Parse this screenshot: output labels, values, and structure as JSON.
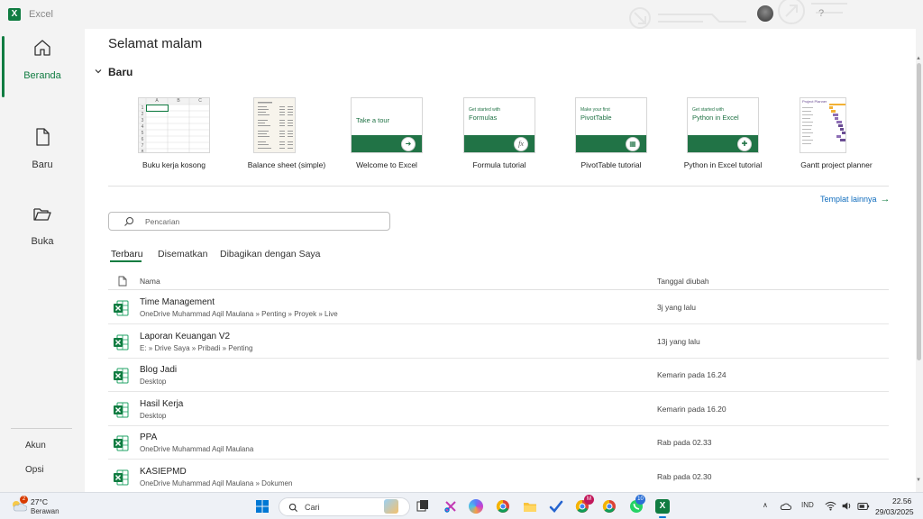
{
  "window": {
    "app_title": "Excel",
    "app_icon_letter": "X",
    "help": "?"
  },
  "nav": {
    "items": [
      {
        "label": "Beranda",
        "icon": "home-icon"
      },
      {
        "label": "Baru",
        "icon": "new-document-icon"
      },
      {
        "label": "Buka",
        "icon": "folder-open-icon"
      }
    ],
    "bottom": {
      "account": "Akun",
      "options": "Opsi"
    }
  },
  "main": {
    "greeting": "Selamat malam",
    "new_section_title": "Baru",
    "templates": [
      {
        "label": "Buku kerja kosong"
      },
      {
        "label": "Balance sheet (simple)"
      },
      {
        "label": "Welcome to Excel",
        "thumb_big": "Take a tour"
      },
      {
        "label": "Formula tutorial",
        "thumb_small": "Get started with",
        "thumb_big": "Formulas",
        "badge": "fx"
      },
      {
        "label": "PivotTable tutorial",
        "thumb_small": "Make your first",
        "thumb_big": "PivotTable"
      },
      {
        "label": "Python in Excel tutorial",
        "thumb_small": "Get started with",
        "thumb_big": "Python in Excel"
      },
      {
        "label": "Gantt project planner",
        "thumb_title": "Project Planner"
      }
    ],
    "blank_grid": {
      "columns": [
        "A",
        "B",
        "C"
      ],
      "rows": [
        "1",
        "2",
        "3",
        "4",
        "5",
        "6",
        "7",
        "8"
      ]
    },
    "more_templates": "Templat lainnya",
    "search_placeholder": "Pencarian",
    "tabs": [
      "Terbaru",
      "Disematkan",
      "Dibagikan dengan Saya"
    ],
    "list_headers": {
      "name": "Nama",
      "date": "Tanggal diubah"
    },
    "files": [
      {
        "name": "Time Management",
        "path": "OneDrive Muhammad Aqil Maulana » Penting » Proyek » Live",
        "date": "3j yang lalu"
      },
      {
        "name": "Laporan Keuangan V2",
        "path": "E: » Drive Saya » Pribadi » Penting",
        "date": "13j yang lalu"
      },
      {
        "name": "Blog Jadi",
        "path": "Desktop",
        "date": "Kemarin pada 16.24"
      },
      {
        "name": "Hasil Kerja",
        "path": "Desktop",
        "date": "Kemarin pada 16.20"
      },
      {
        "name": "PPA",
        "path": "OneDrive Muhammad Aqil Maulana",
        "date": "Rab pada 02.33"
      },
      {
        "name": "KASIEPMD",
        "path": "OneDrive Muhammad Aqil Maulana » Dokumen",
        "date": "Rab pada 02.30"
      }
    ]
  },
  "taskbar": {
    "weather": {
      "temp": "27°C",
      "desc": "Berawan",
      "badge": "2"
    },
    "search_label": "Cari",
    "badges": {
      "chrome_profile": "M",
      "whatsapp": "10"
    },
    "tray": {
      "language": "IND"
    },
    "clock": {
      "time": "22.56",
      "date": "29/03/2025"
    }
  },
  "colors": {
    "accent": "#107c41",
    "excel_green": "#217346",
    "link": "#0f6cbd"
  }
}
